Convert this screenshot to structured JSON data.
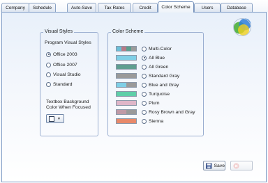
{
  "tabs": [
    {
      "label": "Company"
    },
    {
      "label": "Schedule"
    },
    {
      "label": "Auto-Save"
    },
    {
      "label": "Tax Rates"
    },
    {
      "label": "Credit"
    },
    {
      "label": "Color Scheme"
    },
    {
      "label": "Users"
    },
    {
      "label": "Database"
    }
  ],
  "active_tab": "Color Scheme",
  "visual_styles": {
    "group_title": "Visual Styles",
    "subtitle": "Program Visual Styles",
    "options": [
      {
        "label": "Office 2003",
        "selected": true
      },
      {
        "label": "Office 2007",
        "selected": false
      },
      {
        "label": "Visual Studio",
        "selected": false
      },
      {
        "label": "Standard",
        "selected": false
      }
    ],
    "textbox_bg_line1": "Textbox Background",
    "textbox_bg_line2": "Color When Focused",
    "textbox_bg_color": "#ffffff"
  },
  "color_scheme": {
    "group_title": "Color Scheme",
    "options": [
      {
        "label": "Multi-Color",
        "selected": false,
        "colors": [
          "#6bbfd8",
          "#b77a86",
          "#5a9e8e",
          "#9b9b9b"
        ]
      },
      {
        "label": "All Blue",
        "selected": true,
        "colors": [
          "#7fcfe6"
        ]
      },
      {
        "label": "All Green",
        "selected": false,
        "colors": [
          "#5f9e90"
        ]
      },
      {
        "label": "Standard Gray",
        "selected": false,
        "colors": [
          "#9a9a9a"
        ]
      },
      {
        "label": "Blue and Gray",
        "selected": false,
        "colors": [
          "#7fcfe6",
          "#9a9a9a"
        ]
      },
      {
        "label": "Turquoise",
        "selected": false,
        "colors": [
          "#5fcfa8"
        ]
      },
      {
        "label": "Plum",
        "selected": false,
        "colors": [
          "#dfb6c8"
        ]
      },
      {
        "label": "Rosy Brown and Gray",
        "selected": false,
        "colors": [
          "#bf9aa6",
          "#9a9a9a"
        ]
      },
      {
        "label": "Sienna",
        "selected": false,
        "colors": [
          "#e8896a"
        ]
      }
    ]
  },
  "buttons": {
    "save_label": "Save",
    "close_label": ""
  },
  "colors": {
    "tab_border": "#8aa2c4",
    "page_border": "#7f9cc6",
    "group_border": "#9aaed0",
    "logo_green": "#4caf3a",
    "logo_yellow": "#f0cf1e",
    "logo_blue": "#2f7fd8"
  },
  "icons": {
    "logo": "overlapping-circles-logo",
    "save": "floppy-disk-icon",
    "close": "close-icon",
    "color_picker": "chevron-down-icon"
  }
}
